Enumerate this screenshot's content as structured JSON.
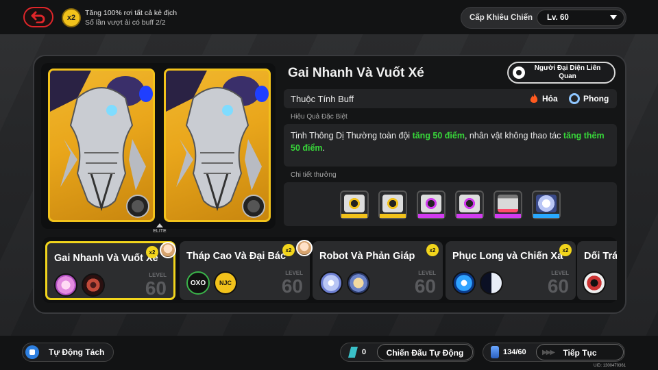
{
  "topbar": {
    "buff_multiplier": "x2",
    "buff_line1": "Tăng 100% rơi tất cả kẻ địch",
    "buff_line2": "Số lần vượt ải có buff 2/2",
    "challenge_level_label": "Cấp Khiêu Chiến",
    "challenge_level_value": "Lv. 60"
  },
  "detail": {
    "title": "Gai Nhanh Và Vuốt Xé",
    "representative_button": "Người Đại Diện Liên Quan",
    "attribute_label": "Thuộc Tính Buff",
    "attributes": [
      {
        "name": "Hỏa",
        "icon": "fire-icon",
        "color": "#ff5a1f"
      },
      {
        "name": "Phong",
        "icon": "wind-icon",
        "color": "#8fc6ff"
      }
    ],
    "special_effect_label": "Hiệu Quả Đặc Biệt",
    "effect_part1": "Tinh Thông Dị Thường toàn đội ",
    "effect_highlight1": "tăng 50 điểm",
    "effect_part2": ", nhân vật không thao tác ",
    "effect_highlight2": "tăng thêm 50 điểm",
    "effect_part3": ".",
    "reward_label": "Chi tiết thưởng",
    "card_tag": "ELITE",
    "rewards": [
      {
        "rarity": "gold",
        "color": "#f2c21b",
        "icon": "disk-drive-icon"
      },
      {
        "rarity": "gold",
        "color": "#f2c21b",
        "icon": "disk-drive-icon"
      },
      {
        "rarity": "purple",
        "color": "#d23cf0",
        "icon": "disk-drive-icon"
      },
      {
        "rarity": "purple",
        "color": "#d23cf0",
        "icon": "disk-drive-icon"
      },
      {
        "rarity": "purple",
        "color": "#d23cf0",
        "icon": "battery-icon"
      },
      {
        "rarity": "blue",
        "color": "#29a9ff",
        "icon": "star-material-icon"
      }
    ]
  },
  "challenges": [
    {
      "name": "Gai Nhanh Và Vuốt Xé",
      "multiplier": "x2",
      "level_label": "LEVEL",
      "level": "60",
      "selected": true
    },
    {
      "name": "Tháp Cao Và Đại Bác",
      "multiplier": "x2",
      "level_label": "LEVEL",
      "level": "60",
      "selected": false
    },
    {
      "name": "Robot Và Phản Giáp",
      "multiplier": "x2",
      "level_label": "LEVEL",
      "level": "60",
      "selected": false
    },
    {
      "name": "Phục Long và Chiến Xa",
      "multiplier": "x2",
      "level_label": "LEVEL",
      "level": "60",
      "selected": false
    },
    {
      "name": "Dối Trá",
      "multiplier": "",
      "level_label": "",
      "level": "",
      "selected": false
    }
  ],
  "challenge_marks": {
    "oxo_text": "OXO",
    "njc_text": "NJC"
  },
  "footer": {
    "auto_separate": "Tự Động Tách",
    "ticket_count": "0",
    "auto_fight": "Chiến Đấu Tự Động",
    "stamina": "134/60",
    "continue": "Tiếp Tục",
    "uid": "UID: 1300470361"
  },
  "colors": {
    "accent_yellow": "#f2d51c",
    "back_red": "#e0262a",
    "highlight_green": "#38d63a"
  }
}
